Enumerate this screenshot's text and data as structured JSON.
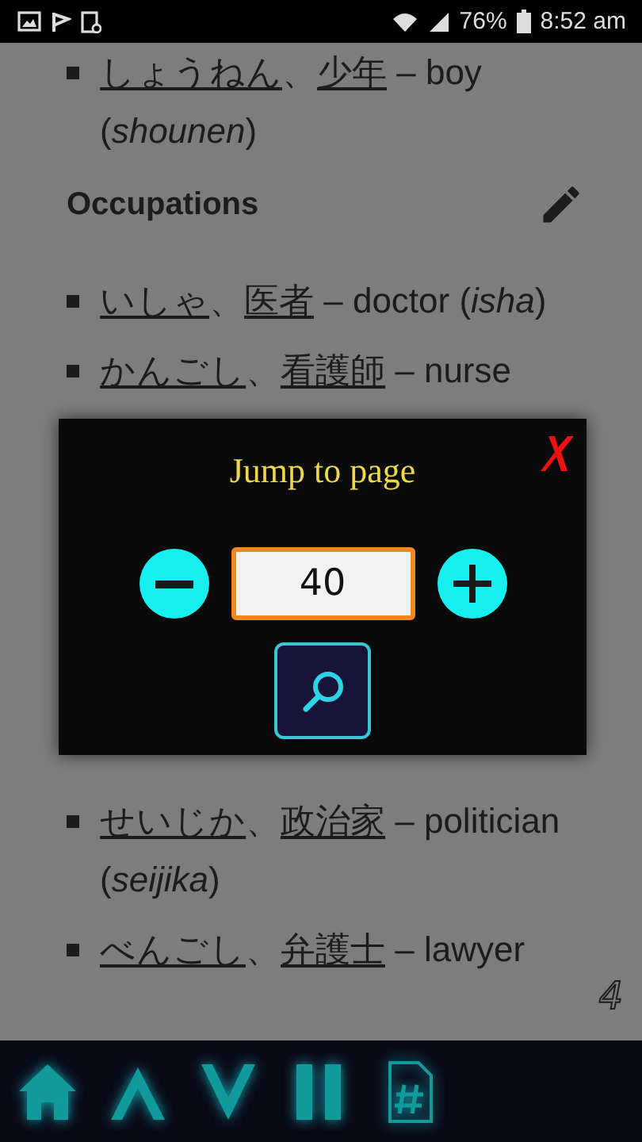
{
  "status_bar": {
    "battery": "76%",
    "time": "8:52 am"
  },
  "content": {
    "blocks": [
      {
        "kind": "item",
        "kana": "しょうねん",
        "separator": "、",
        "kanji": "少年",
        "gloss": "– boy (*shounen*)"
      },
      {
        "kind": "heading",
        "text": "Occupations"
      },
      {
        "kind": "item",
        "kana": "いしゃ",
        "separator": "、",
        "kanji": "医者",
        "gloss": "– doctor (*isha*)"
      },
      {
        "kind": "item",
        "kana": "かんごし",
        "separator": "、",
        "kanji": "看護師",
        "gloss": "– nurse"
      },
      {
        "kind": "spacer"
      },
      {
        "kind": "item",
        "kana": "せいじか",
        "separator": "、",
        "kanji": "政治家",
        "gloss": "– politician (*seijika*)"
      },
      {
        "kind": "item",
        "kana": "べんごし",
        "separator": "、",
        "kanji": "弁護士",
        "gloss": "– lawyer"
      }
    ],
    "page_number": "4"
  },
  "dialog": {
    "title": "Jump to page",
    "value": "40"
  },
  "nav_bar": {
    "buttons": [
      {
        "kind": "home"
      },
      {
        "kind": "up"
      },
      {
        "kind": "down"
      },
      {
        "kind": "pause"
      },
      {
        "kind": "page"
      }
    ]
  }
}
